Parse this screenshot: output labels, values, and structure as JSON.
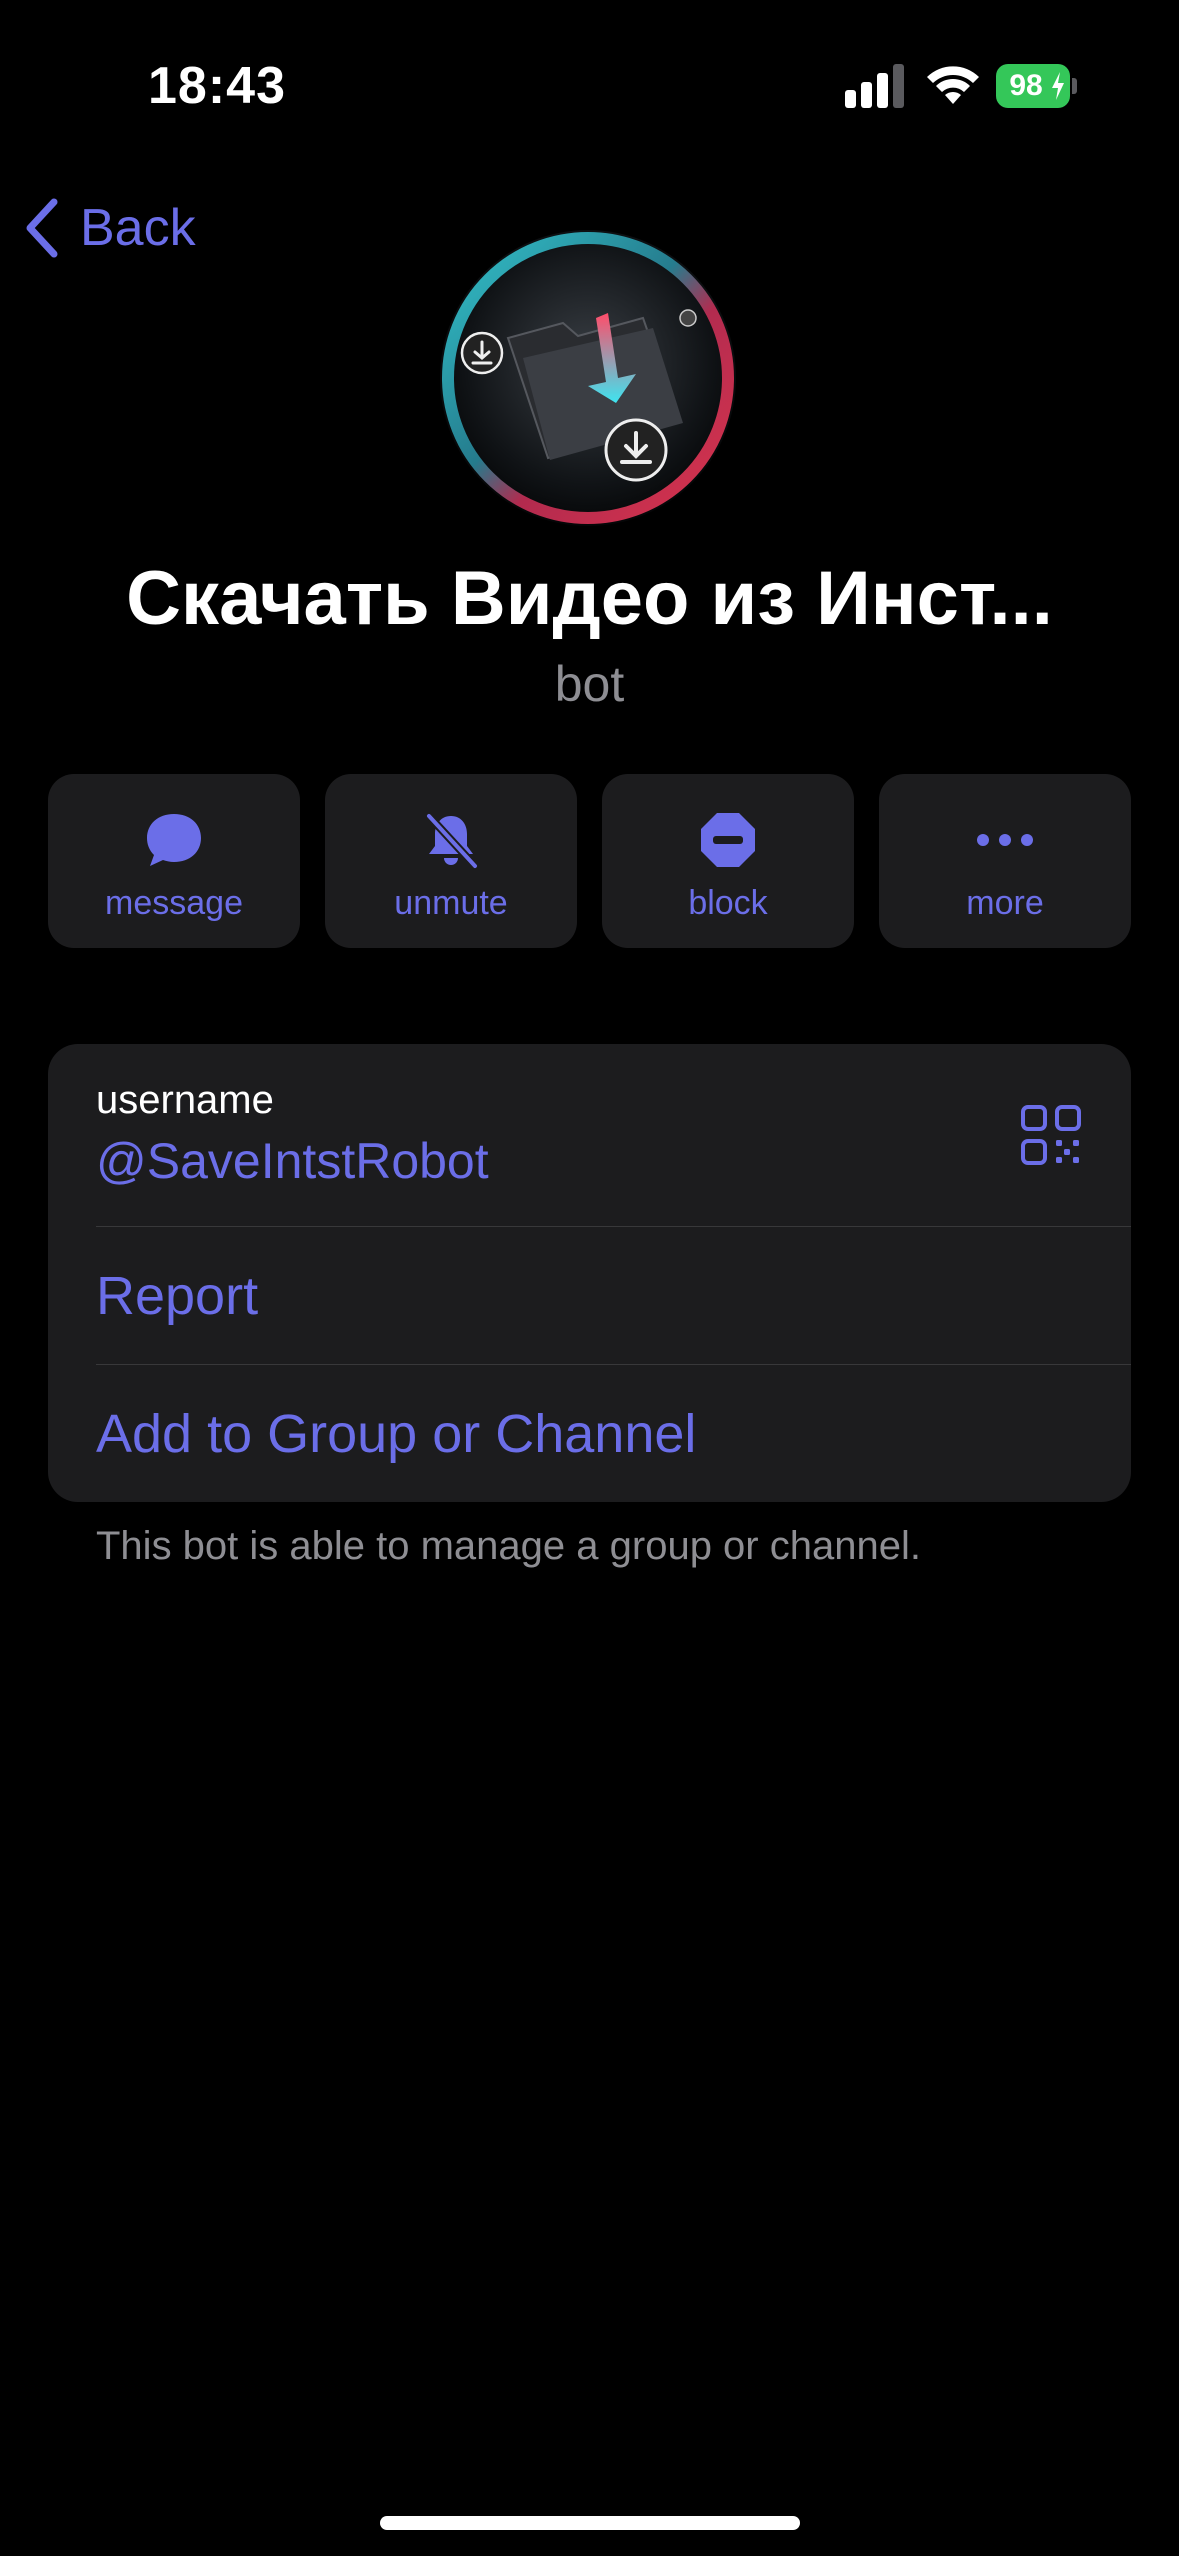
{
  "status_bar": {
    "time": "18:43",
    "battery": "98"
  },
  "nav": {
    "back_label": "Back"
  },
  "profile": {
    "name": "Скачать Видео из Инст...",
    "subtitle": "bot"
  },
  "actions": [
    {
      "label": "message",
      "icon": "message-bubble-icon"
    },
    {
      "label": "unmute",
      "icon": "bell-slash-icon"
    },
    {
      "label": "block",
      "icon": "block-icon"
    },
    {
      "label": "more",
      "icon": "ellipsis-icon"
    }
  ],
  "info": {
    "username_label": "username",
    "username_value": "@SaveIntstRobot",
    "report_label": "Report",
    "add_label": "Add to Group or Channel",
    "footnote": "This bot is able to manage a group or channel."
  },
  "colors": {
    "accent": "#6b6ee8",
    "background": "#000000",
    "card": "#1c1c1e",
    "battery": "#34c759"
  }
}
